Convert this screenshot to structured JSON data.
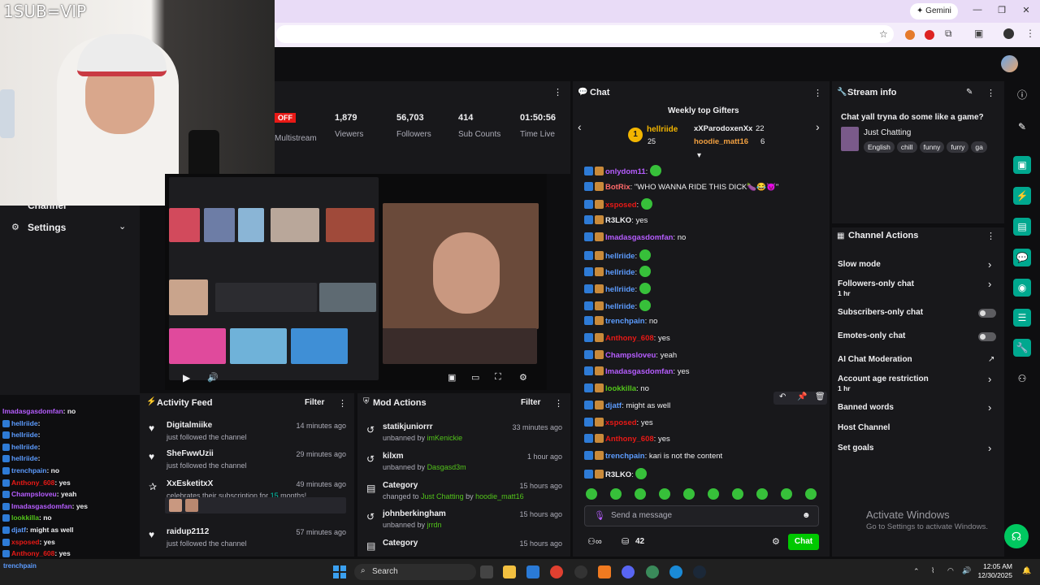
{
  "browser": {
    "gemini_label": "Gemini",
    "window_controls": [
      "—",
      "❐",
      "✕"
    ]
  },
  "webcam": {
    "overlay_text": "1SUB=VIP"
  },
  "leftnav": {
    "items": [
      {
        "label": "Channel",
        "icon": "chevron-down-icon"
      },
      {
        "label": "Settings",
        "icon": "gear-icon"
      }
    ]
  },
  "stats": {
    "off_badge": "OFF",
    "multistream_label": "Multistream",
    "items": [
      {
        "value": "1,879",
        "label": "Viewers"
      },
      {
        "value": "56,703",
        "label": "Followers"
      },
      {
        "value": "414",
        "label": "Sub Counts"
      },
      {
        "value": "01:50:56",
        "label": "Time Live"
      }
    ]
  },
  "activity_feed": {
    "title": "Activity Feed",
    "filter_label": "Filter",
    "items": [
      {
        "name": "Digitalmiike",
        "desc": "just followed the channel",
        "time": "14 minutes ago",
        "icon": "heart-icon"
      },
      {
        "name": "SheFwwUzii",
        "desc": "just followed the channel",
        "time": "29 minutes ago",
        "icon": "heart-icon"
      },
      {
        "name": "XxEsketitxX",
        "desc_pre": "celebrates their subscription for ",
        "desc_highlight": "15",
        "desc_post": " months!",
        "time": "49 minutes ago",
        "icon": "star-icon"
      },
      {
        "name": "raidup2112",
        "desc": "just followed the channel",
        "time": "57 minutes ago",
        "icon": "heart-icon"
      }
    ]
  },
  "mod_actions": {
    "title": "Mod Actions",
    "filter_label": "Filter",
    "items": [
      {
        "name": "statikjuniorrr",
        "desc_pre": "unbanned by ",
        "desc_by": "imKenickie",
        "time": "33 minutes ago"
      },
      {
        "name": "kilxm",
        "desc_pre": "unbanned by ",
        "desc_by": "Dasgasd3m",
        "time": "1 hour ago"
      },
      {
        "name": "Category",
        "desc_pre": "changed to ",
        "desc_by": "Just Chatting",
        "desc_mid": " by ",
        "desc_by2": "hoodie_matt16",
        "time": "15 hours ago"
      },
      {
        "name": "johnberkingham",
        "desc_pre": "unbanned by ",
        "desc_by": "jrrdn",
        "time": "15 hours ago"
      },
      {
        "name": "Category",
        "desc_pre": "",
        "desc_by": "",
        "time": "15 hours ago"
      }
    ]
  },
  "chat": {
    "title": "Chat",
    "gifters_title": "Weekly top Gifters",
    "top_gifter": {
      "name": "hellriide",
      "count": "25",
      "rank": "1"
    },
    "gifters": [
      {
        "name": "xXParodoxenXx",
        "count": "22"
      },
      {
        "name": "hoodie_matt16",
        "count": "6"
      }
    ],
    "messages": [
      {
        "user": "onlydom11",
        "color": "#b65dff",
        "text": ""
      },
      {
        "user": "BotRix",
        "color": "#ff6a6a",
        "text": "\"WHO WANNA RIDE THIS DICK🍆😂😈\""
      },
      {
        "user": "xsposed",
        "color": "#e91916",
        "text": ""
      },
      {
        "user": "R3LKO",
        "color": "#efeff1",
        "text": "yes"
      },
      {
        "user": "Imadasgasdomfan",
        "color": "#b65dff",
        "text": "no"
      },
      {
        "user": "hellriide",
        "color": "#5c9cff",
        "text": ""
      },
      {
        "user": "hellriide",
        "color": "#5c9cff",
        "text": ""
      },
      {
        "user": "hellriide",
        "color": "#5c9cff",
        "text": ""
      },
      {
        "user": "hellriide",
        "color": "#5c9cff",
        "text": ""
      },
      {
        "user": "trenchpain",
        "color": "#5c9cff",
        "text": "no"
      },
      {
        "user": "Anthony_608",
        "color": "#e91916",
        "text": "yes"
      },
      {
        "user": "Champsloveu",
        "color": "#b65dff",
        "text": "yeah"
      },
      {
        "user": "Imadasgasdomfan",
        "color": "#b65dff",
        "text": "yes"
      },
      {
        "user": "lookkilla",
        "color": "#52c41a",
        "text": "no"
      },
      {
        "user": "djatf",
        "color": "#5c9cff",
        "text": "might as well"
      },
      {
        "user": "xsposed",
        "color": "#e91916",
        "text": "yes"
      },
      {
        "user": "Anthony_608",
        "color": "#e91916",
        "text": "yes"
      },
      {
        "user": "trenchpain",
        "color": "#5c9cff",
        "text": "kari is not the content"
      },
      {
        "user": "R3LKO",
        "color": "#efeff1",
        "text": ""
      }
    ],
    "input_placeholder": "Send a message",
    "points": "42",
    "send_label": "Chat"
  },
  "stream_info": {
    "title": "Stream info",
    "stream_title": "Chat yall tryna do some like a game?",
    "category": "Just Chatting",
    "tags": [
      "English",
      "chill",
      "funny",
      "furry",
      "ga"
    ]
  },
  "channel_actions": {
    "title": "Channel Actions",
    "items": [
      {
        "label": "Slow mode",
        "sub": "",
        "control": "chevron"
      },
      {
        "label": "Followers-only chat",
        "sub": "1 hr",
        "control": "chevron"
      },
      {
        "label": "Subscribers-only chat",
        "sub": "",
        "control": "toggle"
      },
      {
        "label": "Emotes-only chat",
        "sub": "",
        "control": "toggle"
      },
      {
        "label": "AI Chat Moderation",
        "sub": "",
        "control": "external"
      },
      {
        "label": "Account age restriction",
        "sub": "1 hr",
        "control": "chevron"
      },
      {
        "label": "Banned words",
        "sub": "",
        "control": "chevron"
      },
      {
        "label": "Host Channel",
        "sub": "",
        "control": "none"
      },
      {
        "label": "Set goals",
        "sub": "",
        "control": "chevron"
      }
    ]
  },
  "overlay_chat": [
    {
      "user": "Imadasgasdomfan",
      "color": "#b65dff",
      "text": ": no"
    },
    {
      "user": "hellriide",
      "color": "#5c9cff",
      "text": ":"
    },
    {
      "user": "hellriide",
      "color": "#5c9cff",
      "text": ":"
    },
    {
      "user": "hellriide",
      "color": "#5c9cff",
      "text": ":"
    },
    {
      "user": "hellriide",
      "color": "#5c9cff",
      "text": ":"
    },
    {
      "user": "trenchpain",
      "color": "#5c9cff",
      "text": ": no"
    },
    {
      "user": "Anthony_608",
      "color": "#e91916",
      "text": ": yes"
    },
    {
      "user": "Champsloveu",
      "color": "#b65dff",
      "text": ": yeah"
    },
    {
      "user": "Imadasgasdomfan",
      "color": "#b65dff",
      "text": ": yes"
    },
    {
      "user": "lookkilla",
      "color": "#52c41a",
      "text": ": no"
    },
    {
      "user": "djatf",
      "color": "#5c9cff",
      "text": ": might as well"
    },
    {
      "user": "xsposed",
      "color": "#e91916",
      "text": ": yes"
    },
    {
      "user": "Anthony_608",
      "color": "#e91916",
      "text": ": yes"
    },
    {
      "user": "trenchpain",
      "color": "#5c9cff",
      "text": ": kari is not the content"
    },
    {
      "user": "R3LKO",
      "color": "#efeff1",
      "text": ":"
    }
  ],
  "activate_windows": {
    "title": "Activate Windows",
    "sub": "Go to Settings to activate Windows."
  },
  "taskbar": {
    "search_label": "Search",
    "time": "12:05 AM",
    "date": "12/30/2025"
  },
  "colors": {
    "accent": "#00c8af",
    "twitch_bg": "#18181b",
    "green_btn": "#00c800"
  }
}
